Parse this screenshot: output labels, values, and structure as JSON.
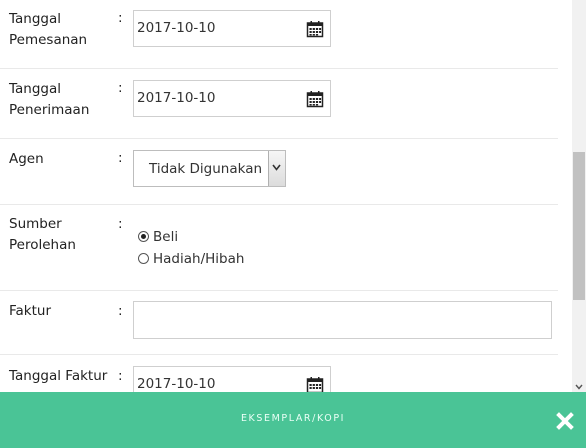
{
  "form": {
    "colon": ":",
    "tanggal_pemesanan": {
      "label": "Tanggal Pemesanan",
      "value": "2017-10-10"
    },
    "tanggal_penerimaan": {
      "label": "Tanggal Penerimaan",
      "value": "2017-10-10"
    },
    "agen": {
      "label": "Agen",
      "selected": "Tidak Digunakan"
    },
    "sumber_perolehan": {
      "label": "Sumber Perolehan",
      "options": [
        {
          "label": "Beli",
          "checked": true
        },
        {
          "label": "Hadiah/Hibah",
          "checked": false
        }
      ]
    },
    "faktur": {
      "label": "Faktur",
      "value": ""
    },
    "tanggal_faktur": {
      "label": "Tanggal Faktur",
      "value": "2017-10-10"
    }
  },
  "footer": {
    "title": "EKSEMPLAR/KOPI",
    "close_icon": "close-icon"
  },
  "icons": {
    "calendar": "calendar-icon",
    "dropdown": "chevron-down-icon"
  },
  "colors": {
    "footer_bg": "#4ac496",
    "footer_text": "#eafff6"
  }
}
